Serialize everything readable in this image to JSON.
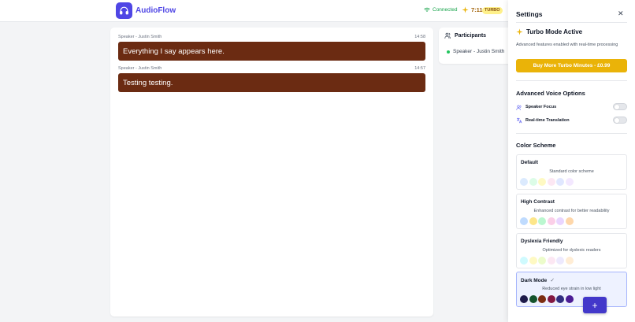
{
  "app": {
    "name": "AudioFlow",
    "brand_color": "#4f46e5"
  },
  "status": {
    "connection": "Connected",
    "timer": "7:11",
    "badge": "TURBO"
  },
  "transcript": {
    "messages": [
      {
        "speaker": "Speaker - Justin Smith",
        "time": "14:58",
        "text": "Everything I say appears here."
      },
      {
        "speaker": "Speaker - Justin Smith",
        "time": "14:57",
        "text": "Testing testing."
      }
    ],
    "bubble_color": "#6b2b12"
  },
  "participants": {
    "title": "Participants",
    "items": [
      {
        "name": "Speaker - Justin Smith",
        "status_color": "#22c55e"
      }
    ]
  },
  "settings": {
    "title": "Settings",
    "close_icon": "close-icon",
    "turbo": {
      "title": "Turbo Mode Active",
      "description": "Advanced features enabled with real-time processing",
      "buy_label": "Buy More Turbo Minutes - £0.99"
    },
    "voice_options": {
      "title": "Advanced Voice Options",
      "items": [
        {
          "label": "Speaker Focus",
          "icon": "users-icon",
          "enabled": false
        },
        {
          "label": "Real-time Translation",
          "icon": "translate-icon",
          "enabled": false
        }
      ]
    },
    "color_scheme": {
      "title": "Color Scheme",
      "selected": "Dark Mode",
      "schemes": [
        {
          "name": "Default",
          "description": "Standard color scheme",
          "colors": [
            "#dbeafe",
            "#dcfce7",
            "#fef9c3",
            "#fce7f3",
            "#e0e7ff",
            "#f3e8ff"
          ]
        },
        {
          "name": "High Contrast",
          "description": "Enhanced contrast for better readability",
          "colors": [
            "#bfdbfe",
            "#fde68a",
            "#bbf7d0",
            "#fbcfe8",
            "#e9d5ff",
            "#fed7aa"
          ]
        },
        {
          "name": "Dyslexia Friendly",
          "description": "Optimized for dyslexic readers",
          "colors": [
            "#cffafe",
            "#fef9c3",
            "#ecfccb",
            "#fce7f3",
            "#ede9fe",
            "#ffedd5"
          ]
        },
        {
          "name": "Dark Mode",
          "description": "Reduced eye strain in low light",
          "colors": [
            "#1e1b4b",
            "#14532d",
            "#7c2d12",
            "#831843",
            "#312e81",
            "#4c1d95"
          ]
        }
      ]
    }
  },
  "fab": {
    "label": "+"
  }
}
